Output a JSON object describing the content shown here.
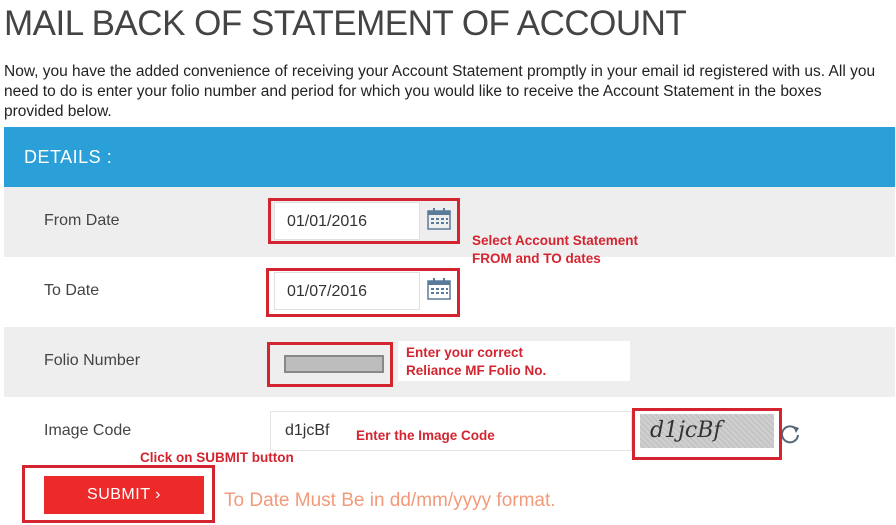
{
  "page": {
    "title": "MAIL BACK OF STATEMENT OF ACCOUNT",
    "intro": "Now, you have the added convenience of receiving your Account Statement promptly in your email id registered with us. All you need to do is enter your folio number and period for which you would like to receive the Account Statement in the boxes provided below."
  },
  "details": {
    "header": "DETAILS :",
    "from_date": {
      "label": "From Date",
      "value": "01/01/2016"
    },
    "to_date": {
      "label": "To Date",
      "value": "01/07/2016"
    },
    "folio": {
      "label": "Folio Number",
      "value": ""
    },
    "image_code": {
      "label": "Image Code",
      "value": "d1jcBf",
      "captcha_text": "d1jcBf"
    },
    "submit_label": "SUBMIT ›",
    "error": "To Date Must Be in dd/mm/yyyy format."
  },
  "annotations": {
    "dates_line1": "Select Account Statement",
    "dates_line2": "FROM and TO dates",
    "folio_line1": "Enter your correct",
    "folio_line2": "Reliance MF Folio No.",
    "image_code": "Enter the Image Code",
    "submit": "Click on SUBMIT button"
  },
  "colors": {
    "header_bg": "#2a9fd8",
    "submit_bg": "#ed2a2a",
    "annotation_red": "#d32430",
    "error_text": "#f39a7a"
  },
  "icons": {
    "calendar": "calendar-icon",
    "refresh": "refresh-icon"
  }
}
